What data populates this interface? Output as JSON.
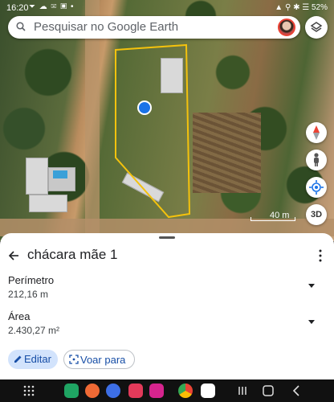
{
  "status_bar": {
    "time": "16:20",
    "left_icons": "⏷ ☁ ✉ ▣ •",
    "right_icons": "▲ ⚲ ✱ ☰ 52%"
  },
  "search": {
    "placeholder": "Pesquisar no Google Earth"
  },
  "map": {
    "scale_label": "40 m"
  },
  "map_buttons": {
    "btn_3d": "3D"
  },
  "sheet": {
    "title": "chácara mãe 1",
    "perimeter": {
      "label": "Perímetro",
      "value": "212,16 m"
    },
    "area": {
      "label": "Área",
      "value": "2.430,27 m²"
    },
    "edit_label": "Editar",
    "fly_label": "Voar para"
  },
  "colors": {
    "accent": "#1a73e8",
    "polygon": "#f4c20d",
    "chip_bg": "#d2e3fc"
  },
  "icons": [
    "search-icon",
    "avatar",
    "layers-icon",
    "compass-icon",
    "pegman-icon",
    "my-location-icon",
    "back-arrow-icon",
    "more-vert-icon",
    "caret-down-icon",
    "pencil-icon",
    "fly-to-icon"
  ]
}
